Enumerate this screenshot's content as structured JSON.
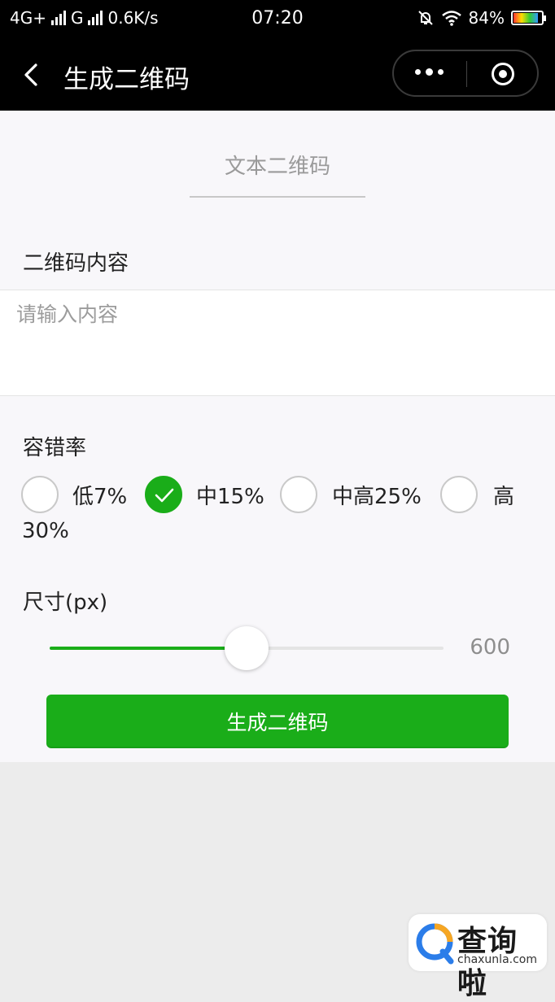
{
  "status_bar": {
    "network_1": "4G+",
    "network_2": "G",
    "speed": "0.6K/s",
    "time": "07:20",
    "battery": "84%",
    "icons": [
      "signal-icon",
      "mute-bell-icon",
      "wifi-icon",
      "battery-icon"
    ]
  },
  "nav": {
    "title": "生成二维码",
    "back_icon": "chevron-left-icon",
    "more_icon": "more-dots-icon",
    "close_icon": "target-circle-icon"
  },
  "tab": {
    "label": "文本二维码"
  },
  "content_section": {
    "label": "二维码内容",
    "placeholder": "请输入内容"
  },
  "error_correction": {
    "label": "容错率",
    "options": [
      {
        "label": "低7%",
        "checked": false
      },
      {
        "label": "中15%",
        "checked": true
      },
      {
        "label": "中高25%",
        "checked": false
      },
      {
        "label_line1": "高",
        "label_line2": "30%",
        "checked": false
      }
    ]
  },
  "size": {
    "label": "尺寸(px)",
    "value": "600",
    "slider_fraction": 0.5
  },
  "generate_button": {
    "label": "生成二维码"
  },
  "watermark": {
    "cn": "查询啦",
    "en": "chaxunla.com"
  },
  "colors": {
    "accent": "#1aad19",
    "navbar": "#000000",
    "page_bg": "#f8f7fa",
    "bottom_bg": "#ececec"
  }
}
